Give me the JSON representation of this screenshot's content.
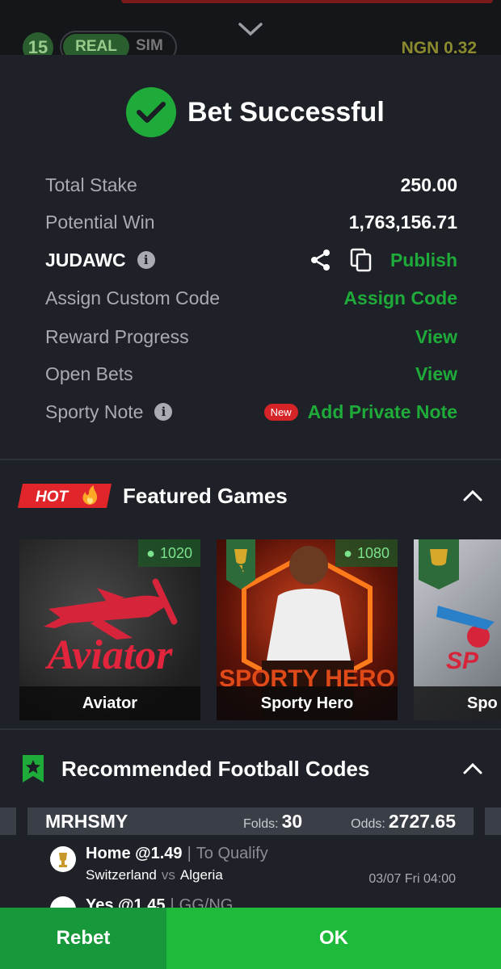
{
  "top": {
    "count": "15",
    "mode_real": "REAL",
    "mode_sim": "SIM",
    "balance": "NGN 0.32"
  },
  "result": {
    "title": "Bet Successful",
    "total_stake_label": "Total Stake",
    "total_stake": "250.00",
    "potential_win_label": "Potential Win",
    "potential_win": "1,763,156.71",
    "booking_code": "JUDAWC",
    "publish_label": "Publish",
    "assign_label": "Assign Custom Code",
    "assign_action": "Assign Code",
    "reward_label": "Reward Progress",
    "reward_action": "View",
    "open_bets_label": "Open Bets",
    "open_bets_action": "View",
    "note_label": "Sporty Note",
    "note_badge": "New",
    "note_action": "Add Private Note"
  },
  "featured": {
    "hot_badge": "HOT",
    "title": "Featured Games",
    "games": [
      {
        "name": "Aviator",
        "players": "1020",
        "art_text": "Aviator"
      },
      {
        "name": "Sporty Hero",
        "players": "1080",
        "art_text": "SPORTY HERO"
      },
      {
        "name": "Spo",
        "players": "",
        "art_text": "SP"
      }
    ]
  },
  "recommended": {
    "title": "Recommended Football Codes",
    "card": {
      "code": "MRHSMY",
      "folds_label": "Folds:",
      "folds": "30",
      "odds_label": "Odds:",
      "odds": "2727.65",
      "bets": [
        {
          "pick": "Home @1.49",
          "market": "To Qualify",
          "home": "Switzerland",
          "vs": "vs",
          "away": "Algeria",
          "time": "03/07 Fri 04:00"
        },
        {
          "pick": "Yes @1.45",
          "market": "GG/NG"
        }
      ]
    }
  },
  "footer": {
    "rebet": "Rebet",
    "ok": "OK"
  },
  "colors": {
    "accent_green": "#1fab3a",
    "background": "#1e2127",
    "hot_red": "#e0262b"
  }
}
